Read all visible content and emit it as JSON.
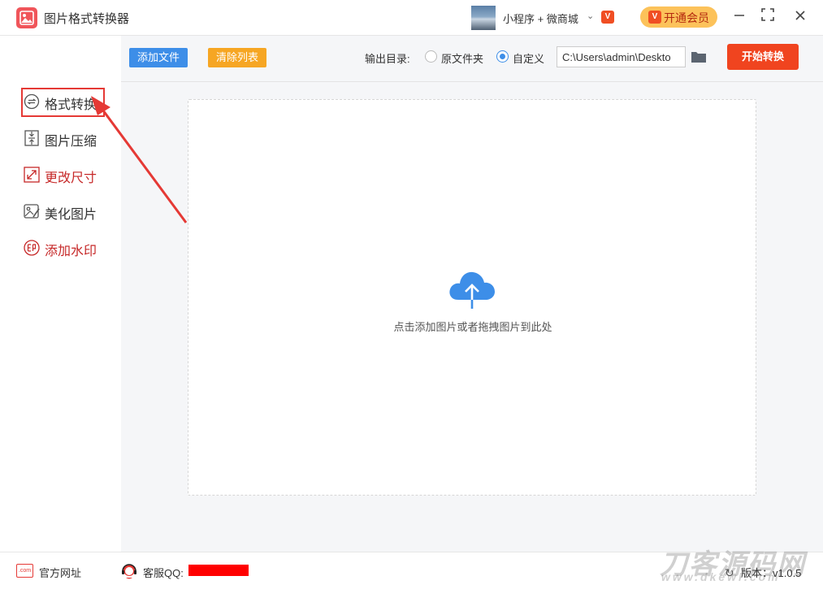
{
  "window": {
    "title": "图片格式转换器",
    "mini_program_label": "小程序 + 微商城",
    "vip_mark": "V",
    "member_button": "开通会员"
  },
  "sidebar": {
    "items": [
      {
        "label": "格式转换",
        "color": "#333333",
        "icon": "format-convert-icon"
      },
      {
        "label": "图片压缩",
        "color": "#333333",
        "icon": "compress-icon"
      },
      {
        "label": "更改尺寸",
        "color": "#c62828",
        "icon": "resize-icon"
      },
      {
        "label": "美化图片",
        "color": "#333333",
        "icon": "beautify-icon"
      },
      {
        "label": "添加水印",
        "color": "#c62828",
        "icon": "watermark-icon"
      }
    ]
  },
  "toolbar": {
    "add_file": "添加文件",
    "clear_list": "清除列表",
    "output_label": "输出目录:",
    "radio_original": "原文件夹",
    "radio_custom": "自定义",
    "output_path": "C:\\Users\\admin\\Deskto",
    "start_button": "开始转换"
  },
  "dropzone": {
    "hint": "点击添加图片或者拖拽图片到此处"
  },
  "footer": {
    "site_icon_text": ".com",
    "site_link": "官方网址",
    "qq_label": "客服QQ:",
    "version": "版本：v1.0.5",
    "watermark": "刀客源码网",
    "watermark_sub": "www.dkewl.com"
  },
  "colors": {
    "accent_blue": "#3d8ee8",
    "accent_orange": "#f6a623",
    "start_red": "#f0441f",
    "annotation_red": "#e53935"
  }
}
